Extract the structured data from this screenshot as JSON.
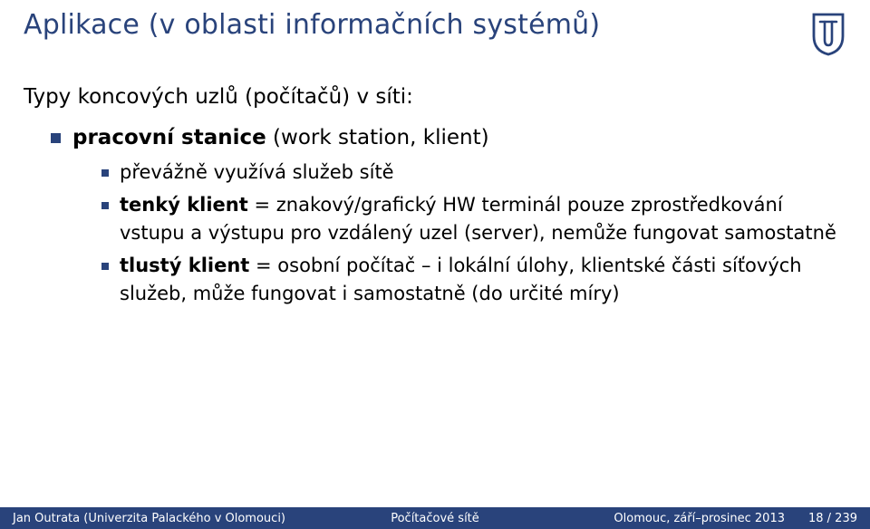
{
  "title": "Aplikace (v oblasti informačních systémů)",
  "subtitle": "Typy koncových uzlů (počítačů) v síti:",
  "bullet1": {
    "lead_bold": "pracovní stanice",
    "rest": " (work station, klient)"
  },
  "sub": {
    "a": "převážně využívá služeb sítě",
    "b": {
      "lead_bold": "tenký klient",
      "rest": " = znakový/grafický HW terminál pouze zprostředkování vstupu a výstupu pro vzdálený uzel (server), nemůže fungovat samostatně"
    },
    "c": {
      "lead_bold": "tlustý klient",
      "rest": " = osobní počítač – i lokální úlohy, klientské části síťových služeb, může fungovat i samostatně (do určité míry)"
    }
  },
  "footer": {
    "left": "Jan Outrata (Univerzita Palackého v Olomouci)",
    "center": "Počítačové sítě",
    "right_date": "Olomouc, září–prosinec 2013",
    "right_page": "18 / 239"
  }
}
